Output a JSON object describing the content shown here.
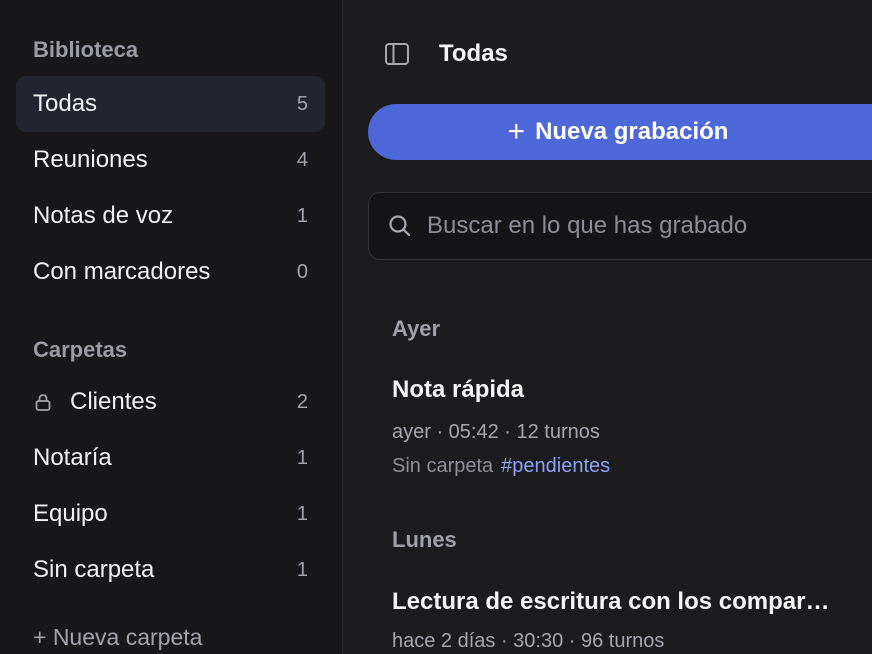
{
  "sidebar": {
    "library_title": "Biblioteca",
    "library_items": [
      {
        "label": "Todas",
        "count": "5"
      },
      {
        "label": "Reuniones",
        "count": "4"
      },
      {
        "label": "Notas de voz",
        "count": "1"
      },
      {
        "label": "Con marcadores",
        "count": "0"
      }
    ],
    "folders_title": "Carpetas",
    "folder_items": [
      {
        "label": "Clientes",
        "count": "2",
        "icon": "lock-icon"
      },
      {
        "label": "Notaría",
        "count": "1"
      },
      {
        "label": "Equipo",
        "count": "1"
      },
      {
        "label": "Sin carpeta",
        "count": "1"
      }
    ],
    "new_folder_label": "+ Nueva carpeta"
  },
  "main": {
    "title": "Todas",
    "new_recording_label": "Nueva grabación",
    "search_placeholder": "Buscar en lo que has grabado",
    "groups": [
      {
        "label": "Ayer",
        "recordings": [
          {
            "title": "Nota rápida",
            "meta": "ayer · 05:42 · 12 turnos",
            "folder": "Sin carpeta",
            "tag": "#pendientes"
          }
        ]
      },
      {
        "label": "Lunes",
        "recordings": [
          {
            "title": "Lectura de escritura con los compar…",
            "meta": "hace 2 días · 30:30 · 96 turnos"
          }
        ]
      }
    ]
  },
  "colors": {
    "accent": "#4f68d9",
    "tag": "#8ea2f5",
    "active_item_bg": "#232631"
  }
}
